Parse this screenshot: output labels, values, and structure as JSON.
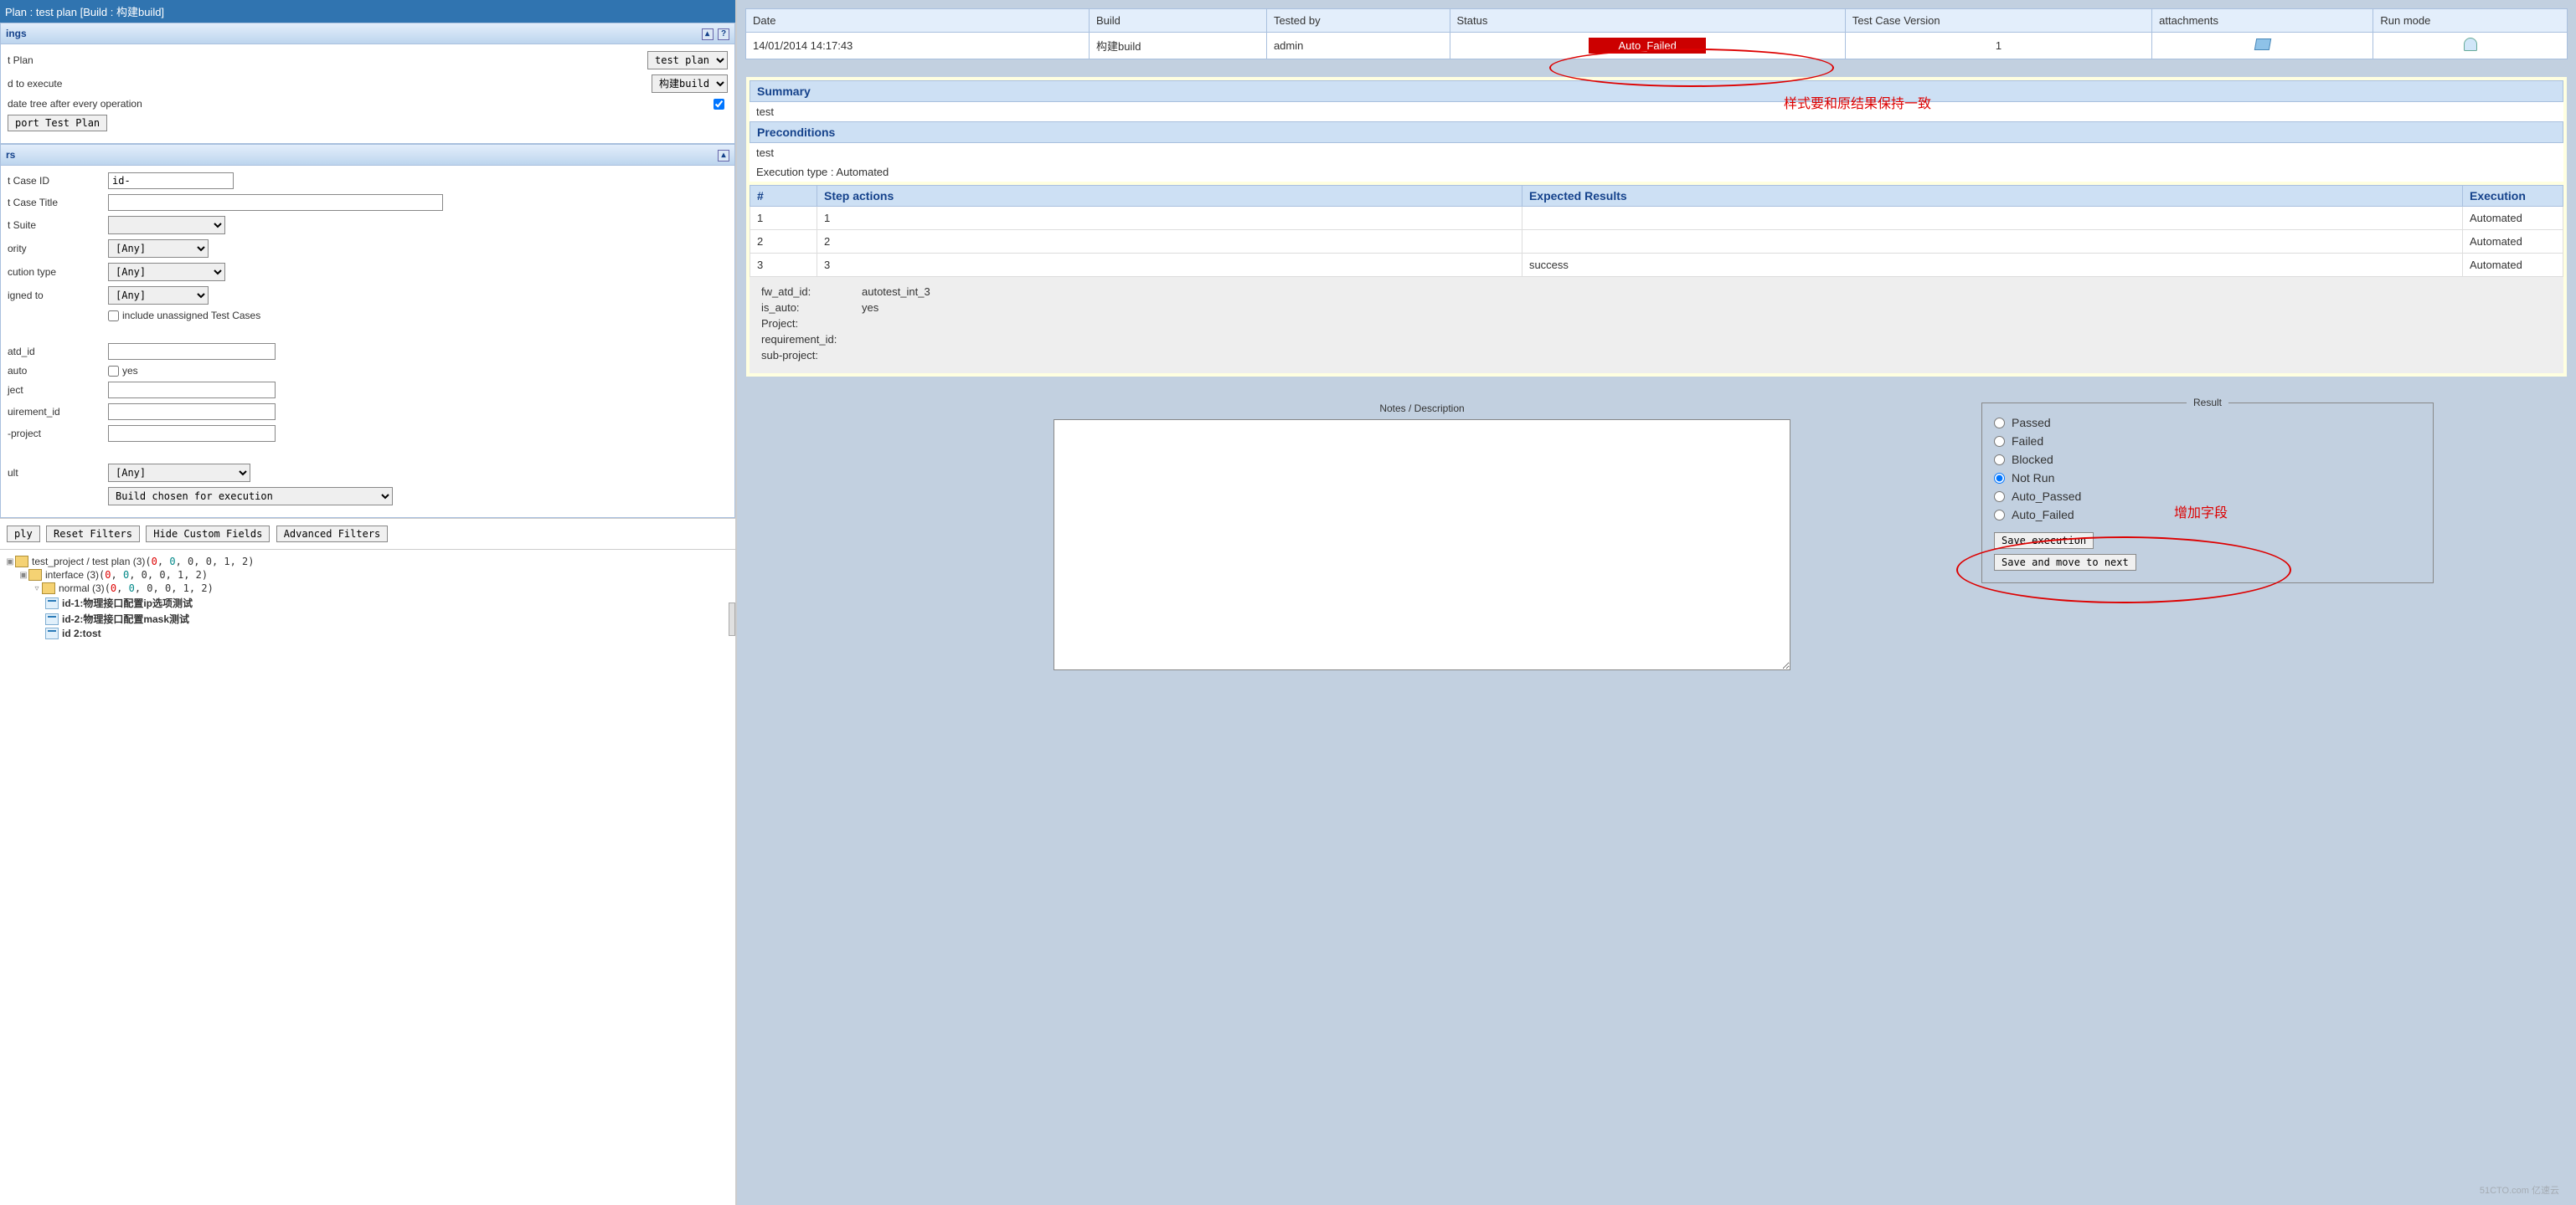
{
  "leftHeader": "Plan : test plan [Build : 构建build]",
  "settings": {
    "title": "ings",
    "rows": {
      "testPlanLabel": "t Plan",
      "testPlanValue": "test plan",
      "buildLabel": "d to execute",
      "buildValue": "构建build",
      "updateTreeLabel": "date tree after every operation",
      "updateTreeChecked": true,
      "exportBtn": "port Test Plan"
    }
  },
  "filters": {
    "title": "rs",
    "testCaseIdLabel": "t Case ID",
    "testCaseIdValue": "id-",
    "testCaseTitleLabel": "t Case Title",
    "testSuiteLabel": "t Suite",
    "priorityLabel": "ority",
    "priorityValue": "[Any]",
    "execTypeLabel": "cution type",
    "execTypeValue": "[Any]",
    "assignedLabel": "igned to",
    "assignedValue": "[Any]",
    "includeUnassigned": "include unassigned Test Cases",
    "atdIdLabel": "atd_id",
    "autoLabel": "auto",
    "autoCheckLabel": "yes",
    "projectLabel": "ject",
    "reqIdLabel": "uirement_id",
    "subProjectLabel": "-project",
    "resultLabel": "ult",
    "resultValue": "[Any]",
    "buildChosenValue": "Build chosen for execution",
    "applyBtn": "ply",
    "resetBtn": "Reset Filters",
    "hideBtn": "Hide Custom Fields",
    "advancedBtn": "Advanced Filters"
  },
  "tree": {
    "root": "test_project / test plan (3)",
    "rootCounts": "(0, 0, 0, 0, 1, 2)",
    "interface": "interface (3)",
    "interfaceCounts": "(0, 0, 0, 0, 1, 2)",
    "normal": "normal (3)",
    "normalCounts": "(0, 0, 0, 0, 1, 2)",
    "item1": "id-1:物理接口配置ip选项测试",
    "item2": "id-2:物理接口配置mask测试",
    "item3": "id 2:tost"
  },
  "execTable": {
    "headers": [
      "Date",
      "Build",
      "Tested by",
      "Status",
      "Test Case Version",
      "attachments",
      "Run mode"
    ],
    "row": {
      "date": "14/01/2014 14:17:43",
      "build": "构建build",
      "testedBy": "admin",
      "status": "Auto_Failed",
      "version": "1"
    }
  },
  "annotation1": "样式要和原结果保持一致",
  "summary": {
    "title": "Summary",
    "body": "test"
  },
  "preconditions": {
    "title": "Preconditions",
    "body": "test"
  },
  "execTypeLine": "Execution type : Automated",
  "steps": {
    "headers": [
      "#",
      "Step actions",
      "Expected Results",
      "Execution"
    ],
    "rows": [
      {
        "n": "1",
        "action": "1",
        "expected": "",
        "exec": "Automated"
      },
      {
        "n": "2",
        "action": "2",
        "expected": "",
        "exec": "Automated"
      },
      {
        "n": "3",
        "action": "3",
        "expected": "success",
        "exec": "Automated"
      }
    ]
  },
  "meta": {
    "fwAtdId": {
      "k": "fw_atd_id:",
      "v": "autotest_int_3"
    },
    "isAuto": {
      "k": "is_auto:",
      "v": "yes"
    },
    "project": {
      "k": "Project:",
      "v": ""
    },
    "reqId": {
      "k": "requirement_id:",
      "v": ""
    },
    "subProject": {
      "k": "sub-project:",
      "v": ""
    }
  },
  "notesTitle": "Notes / Description",
  "result": {
    "legend": "Result",
    "options": [
      "Passed",
      "Failed",
      "Blocked",
      "Not Run",
      "Auto_Passed",
      "Auto_Failed"
    ],
    "selected": "Not Run",
    "saveBtn": "Save execution",
    "saveNextBtn": "Save and move to next"
  },
  "annotation2": "增加字段",
  "watermark": "51CTO.com 亿速云"
}
